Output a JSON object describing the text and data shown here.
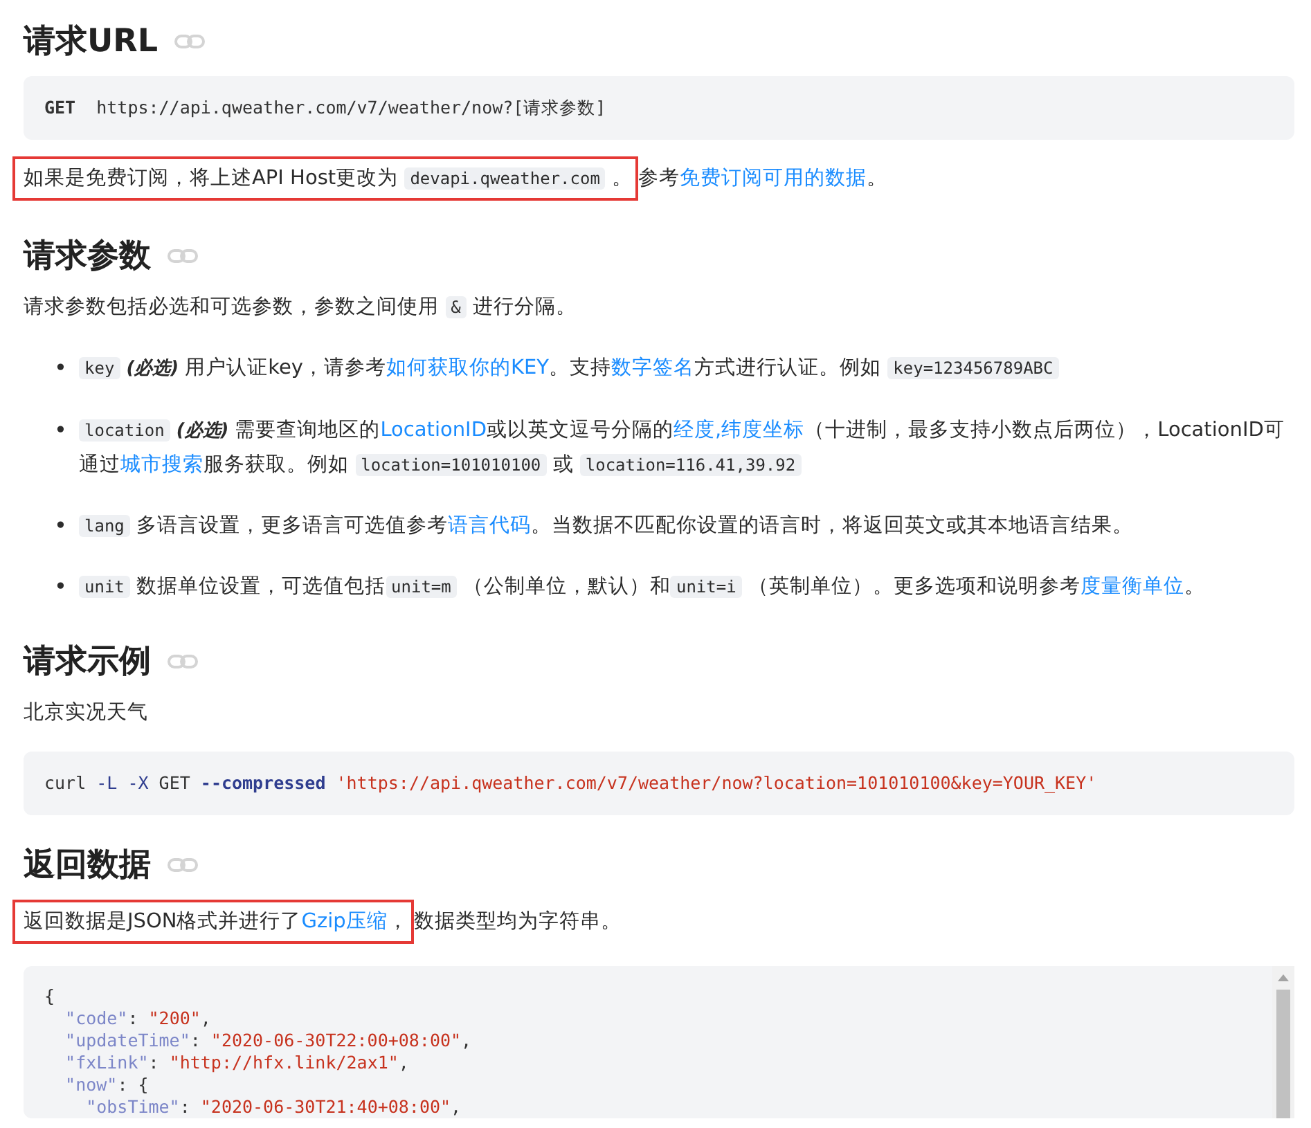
{
  "sections": [
    {
      "heading": "请求URL",
      "blocks": [
        {
          "kind": "code",
          "lines": [
            [
              {
                "kind": "method",
                "text": "GET"
              },
              {
                "kind": "plain",
                "text": "  https://api.qweather.com/v7/weather/now?[请求参数]"
              }
            ]
          ]
        },
        {
          "kind": "paragraph",
          "highlighted": [
            {
              "kind": "text",
              "text": "如果是免费订阅，将上述API Host更改为 "
            },
            {
              "kind": "code",
              "text": "devapi.qweather.com"
            },
            {
              "kind": "text",
              "text": " 。"
            }
          ],
          "segments": [
            {
              "kind": "text",
              "text": "参考"
            },
            {
              "kind": "link",
              "text": "免费订阅可用的数据"
            },
            {
              "kind": "text",
              "text": "。"
            }
          ]
        }
      ]
    },
    {
      "heading": "请求参数",
      "blocks": [
        {
          "kind": "paragraph",
          "segments": [
            {
              "kind": "text",
              "text": "请求参数包括必选和可选参数，参数之间使用 "
            },
            {
              "kind": "code",
              "text": "&"
            },
            {
              "kind": "text",
              "text": " 进行分隔。"
            }
          ]
        },
        {
          "kind": "list",
          "items": [
            {
              "bullet": "•",
              "segments": [
                {
                  "kind": "code",
                  "text": "key"
                },
                {
                  "kind": "em",
                  "text": " (必选) "
                },
                {
                  "kind": "text",
                  "text": "用户认证key，请参考"
                },
                {
                  "kind": "link",
                  "text": "如何获取你的KEY"
                },
                {
                  "kind": "text",
                  "text": "。支持"
                },
                {
                  "kind": "link",
                  "text": "数字签名"
                },
                {
                  "kind": "text",
                  "text": "方式进行认证。例如 "
                },
                {
                  "kind": "code",
                  "text": "key=123456789ABC"
                }
              ]
            },
            {
              "bullet": "•",
              "segments": [
                {
                  "kind": "code",
                  "text": "location"
                },
                {
                  "kind": "em",
                  "text": " (必选) "
                },
                {
                  "kind": "text",
                  "text": "需要查询地区的"
                },
                {
                  "kind": "link",
                  "text": "LocationID"
                },
                {
                  "kind": "text",
                  "text": "或以英文逗号分隔的"
                },
                {
                  "kind": "link",
                  "text": "经度,纬度坐标"
                },
                {
                  "kind": "text",
                  "text": "（十进制，最多支持小数点后两位），LocationID可通过"
                },
                {
                  "kind": "link",
                  "text": "城市搜索"
                },
                {
                  "kind": "text",
                  "text": "服务获取。例如 "
                },
                {
                  "kind": "code",
                  "text": "location=101010100"
                },
                {
                  "kind": "text",
                  "text": " 或 "
                },
                {
                  "kind": "code",
                  "text": "location=116.41,39.92"
                }
              ]
            },
            {
              "bullet": "•",
              "segments": [
                {
                  "kind": "code",
                  "text": "lang"
                },
                {
                  "kind": "text",
                  "text": " 多语言设置，更多语言可选值参考"
                },
                {
                  "kind": "link",
                  "text": "语言代码"
                },
                {
                  "kind": "text",
                  "text": "。当数据不匹配你设置的语言时，将返回英文或其本地语言结果。"
                }
              ]
            },
            {
              "bullet": "•",
              "segments": [
                {
                  "kind": "code",
                  "text": "unit"
                },
                {
                  "kind": "text",
                  "text": " 数据单位设置，可选值包括"
                },
                {
                  "kind": "code",
                  "text": "unit=m"
                },
                {
                  "kind": "text",
                  "text": " （公制单位，默认）和"
                },
                {
                  "kind": "code",
                  "text": "unit=i"
                },
                {
                  "kind": "text",
                  "text": " （英制单位）。更多选项和说明参考"
                },
                {
                  "kind": "link",
                  "text": "度量衡单位"
                },
                {
                  "kind": "text",
                  "text": "。"
                }
              ]
            }
          ]
        }
      ]
    },
    {
      "heading": "请求示例",
      "blocks": [
        {
          "kind": "paragraph",
          "segments": [
            {
              "kind": "text",
              "text": "北京实况天气"
            }
          ]
        },
        {
          "kind": "code",
          "lines": [
            [
              {
                "kind": "plain",
                "text": "curl "
              },
              {
                "kind": "flag",
                "text": "-L"
              },
              {
                "kind": "flag",
                "text": " -X"
              },
              {
                "kind": "plain",
                "text": " GET "
              },
              {
                "kind": "flag",
                "text": "--compressed"
              },
              {
                "kind": "string",
                "text": " 'https://api.qweather.com/v7/weather/now?location=101010100&key=YOUR_KEY'"
              }
            ]
          ]
        }
      ]
    },
    {
      "heading": "返回数据",
      "blocks": [
        {
          "kind": "paragraph",
          "highlighted": [
            {
              "kind": "text",
              "text": "返回数据是JSON格式并进行了"
            },
            {
              "kind": "link",
              "text": "Gzip压缩"
            },
            {
              "kind": "text",
              "text": "，"
            }
          ],
          "segments": [
            {
              "kind": "text",
              "text": "数据类型均为字符串。"
            }
          ]
        },
        {
          "kind": "code",
          "scrollable": true,
          "lines": [
            [
              {
                "kind": "plain",
                "text": "{"
              }
            ],
            [
              {
                "kind": "key",
                "text": "  \"code\""
              },
              {
                "kind": "plain",
                "text": ": "
              },
              {
                "kind": "string",
                "text": "\"200\""
              },
              {
                "kind": "plain",
                "text": ","
              }
            ],
            [
              {
                "kind": "key",
                "text": "  \"updateTime\""
              },
              {
                "kind": "plain",
                "text": ": "
              },
              {
                "kind": "string",
                "text": "\"2020-06-30T22:00+08:00\""
              },
              {
                "kind": "plain",
                "text": ","
              }
            ],
            [
              {
                "kind": "key",
                "text": "  \"fxLink\""
              },
              {
                "kind": "plain",
                "text": ": "
              },
              {
                "kind": "string",
                "text": "\"http://hfx.link/2ax1\""
              },
              {
                "kind": "plain",
                "text": ","
              }
            ],
            [
              {
                "kind": "key",
                "text": "  \"now\""
              },
              {
                "kind": "plain",
                "text": ": {"
              }
            ],
            [
              {
                "kind": "key",
                "text": "    \"obsTime\""
              },
              {
                "kind": "plain",
                "text": ": "
              },
              {
                "kind": "string",
                "text": "\"2020-06-30T21:40+08:00\""
              },
              {
                "kind": "plain",
                "text": ","
              }
            ]
          ]
        }
      ]
    }
  ]
}
